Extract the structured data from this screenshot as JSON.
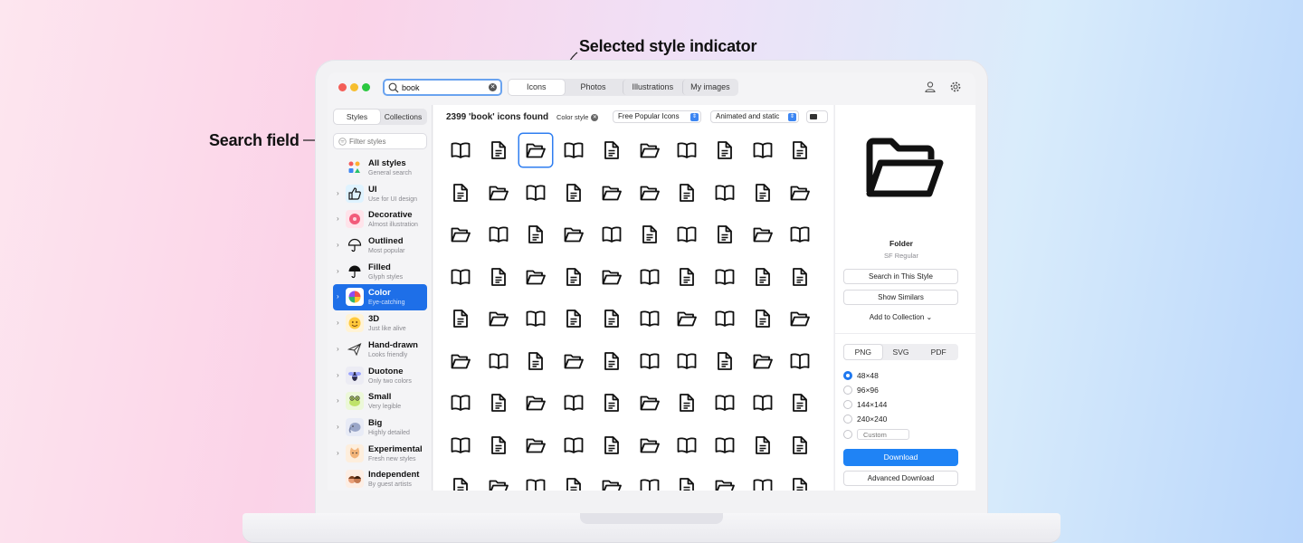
{
  "annotations": {
    "search_field": "Search field",
    "selected_style": "Selected style indicator"
  },
  "search": {
    "value": "book"
  },
  "top_tabs": [
    "Icons",
    "Photos",
    "Illustrations",
    "My images"
  ],
  "sidebar": {
    "tabs": [
      "Styles",
      "Collections"
    ],
    "filter_placeholder": "Filter styles",
    "items": [
      {
        "name": "All styles",
        "desc": "General search",
        "icon": "all-styles-icon"
      },
      {
        "name": "UI",
        "desc": "Use for UI design",
        "icon": "thumbs-up-icon"
      },
      {
        "name": "Decorative",
        "desc": "Almost illustration",
        "icon": "flower-icon"
      },
      {
        "name": "Outlined",
        "desc": "Most popular",
        "icon": "umbrella-outline-icon"
      },
      {
        "name": "Filled",
        "desc": "Glyph styles",
        "icon": "umbrella-filled-icon"
      },
      {
        "name": "Color",
        "desc": "Eye-catching",
        "icon": "color-wheel-icon"
      },
      {
        "name": "3D",
        "desc": "Just like alive",
        "icon": "emoji-3d-icon"
      },
      {
        "name": "Hand-drawn",
        "desc": "Looks friendly",
        "icon": "paper-plane-icon"
      },
      {
        "name": "Duotone",
        "desc": "Only two colors",
        "icon": "bee-icon"
      },
      {
        "name": "Small",
        "desc": "Very legible",
        "icon": "frog-icon"
      },
      {
        "name": "Big",
        "desc": "Highly detailed",
        "icon": "elephant-icon"
      },
      {
        "name": "Experimental",
        "desc": "Fresh new styles",
        "icon": "cat-icon"
      },
      {
        "name": "Independent",
        "desc": "By guest artists",
        "icon": "faces-icon"
      }
    ],
    "selected_index": 5
  },
  "results": {
    "count_text": "2399 'book' icons found",
    "color_chip": "Color style",
    "dropdown_popular": "Free Popular Icons",
    "dropdown_animated": "Animated and static"
  },
  "grid": {
    "rows": [
      [
        "book",
        "doc",
        "folder",
        "book",
        "doc",
        "folder",
        "book",
        "doc",
        "book",
        "doc"
      ],
      [
        "doc",
        "folder",
        "book",
        "doc",
        "folder",
        "folder",
        "doc",
        "book",
        "doc",
        "folder"
      ],
      [
        "folder",
        "book",
        "doc",
        "folder",
        "book",
        "doc",
        "book",
        "doc",
        "folder",
        "book"
      ],
      [
        "book",
        "doc",
        "folder",
        "doc",
        "folder",
        "book",
        "doc",
        "book",
        "doc",
        "doc"
      ],
      [
        "doc",
        "folder",
        "book",
        "doc",
        "doc",
        "book",
        "folder",
        "book",
        "doc",
        "folder"
      ],
      [
        "folder",
        "book",
        "doc",
        "folder",
        "doc",
        "book",
        "book",
        "doc",
        "folder",
        "book"
      ],
      [
        "book",
        "doc",
        "folder",
        "book",
        "doc",
        "folder",
        "doc",
        "book",
        "book",
        "doc"
      ],
      [
        "book",
        "doc",
        "folder",
        "book",
        "doc",
        "folder",
        "book",
        "book",
        "doc",
        "doc"
      ],
      [
        "doc",
        "folder",
        "book",
        "doc",
        "folder",
        "book",
        "doc",
        "folder",
        "book",
        "doc"
      ]
    ],
    "selected": [
      0,
      2
    ]
  },
  "detail": {
    "name": "Folder",
    "style": "SF Regular",
    "search_style": "Search in This Style",
    "show_similars": "Show Similars",
    "add_collection": "Add to Collection",
    "formats": [
      "PNG",
      "SVG",
      "PDF"
    ],
    "active_format": 0,
    "sizes": [
      "48×48",
      "96×96",
      "144×144",
      "240×240"
    ],
    "selected_size": 0,
    "custom_placeholder": "Custom",
    "download": "Download",
    "advanced_download": "Advanced Download"
  },
  "colors": {
    "accent": "#1e6fe8",
    "download": "#1f83f5"
  }
}
